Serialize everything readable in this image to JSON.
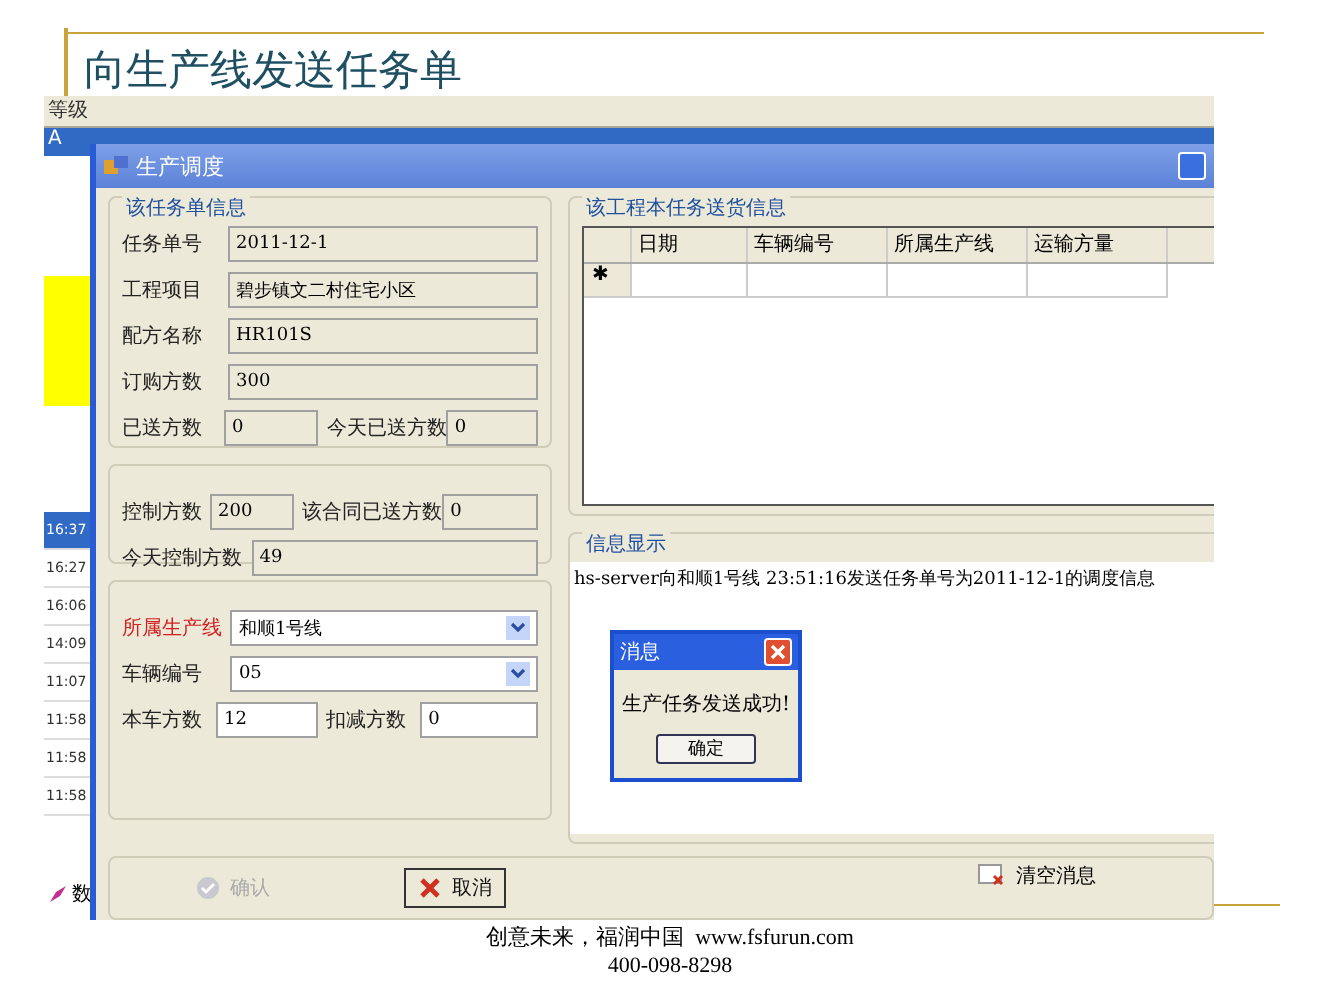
{
  "slide": {
    "title": "向生产线发送任务单"
  },
  "background_app": {
    "column": "等级",
    "selected_cell": "A",
    "times": [
      {
        "text": "16:37",
        "selected": true
      },
      {
        "text": "16:27",
        "selected": false
      },
      {
        "text": "16:06",
        "selected": false
      },
      {
        "text": "14:09",
        "selected": false
      },
      {
        "text": "11:07",
        "selected": false
      },
      {
        "text": "11:58",
        "selected": false
      },
      {
        "text": "11:58",
        "selected": false
      },
      {
        "text": "11:58",
        "selected": false
      }
    ],
    "toolbar_label": "数"
  },
  "dialog": {
    "title": "生产调度",
    "task_group": {
      "title": "该任务单信息",
      "rows": [
        [
          {
            "label": "任务单号",
            "value": "2011-12-1"
          }
        ],
        [
          {
            "label": "工程项目",
            "value": "碧步镇文二村住宅小区"
          }
        ],
        [
          {
            "label": "配方名称",
            "value": "HR101S"
          }
        ],
        [
          {
            "label": "订购方数",
            "value": "300"
          }
        ],
        [
          {
            "label": "已送方数",
            "value": "0"
          },
          {
            "label": "今天已送方数",
            "value": "0"
          }
        ]
      ]
    },
    "control_group": {
      "rows": [
        [
          {
            "label": "控制方数",
            "value": "200"
          },
          {
            "label": "该合同已送方数",
            "value": "0"
          }
        ],
        [
          {
            "label": "今天控制方数",
            "value": "49"
          }
        ]
      ]
    },
    "line_group": {
      "rows": [
        [
          {
            "label": "所属生产线",
            "value": "和顺1号线",
            "kind": "select",
            "highlighted": true
          }
        ],
        [
          {
            "label": "车辆编号",
            "value": "05",
            "kind": "select",
            "highlighted": false
          }
        ],
        [
          {
            "label": "本车方数",
            "value": "12",
            "kind": "text",
            "highlighted": false
          },
          {
            "label": "扣减方数",
            "value": "0",
            "kind": "text",
            "highlighted": false
          }
        ]
      ]
    },
    "delivery_group": {
      "title": "该工程本任务送货信息",
      "columns": [
        "日期",
        "车辆编号",
        "所属生产线",
        "运输方量"
      ],
      "new_row_marker": "✱"
    },
    "info_group": {
      "title": "信息显示",
      "log": "hs-server向和顺1号线 23:51:16发送任务单号为2011-12-1的调度信息"
    },
    "message_box": {
      "title": "消息",
      "text": "生产任务发送成功!",
      "button": "确定"
    },
    "actions": [
      {
        "label": "确认",
        "disabled": true
      },
      {
        "label": "取消",
        "disabled": false
      }
    ],
    "clear_button": "清空消息"
  },
  "footer": {
    "line_1": "创意未来，福润中国  www.fsfurun.com",
    "line_2": "400-098-8298"
  }
}
